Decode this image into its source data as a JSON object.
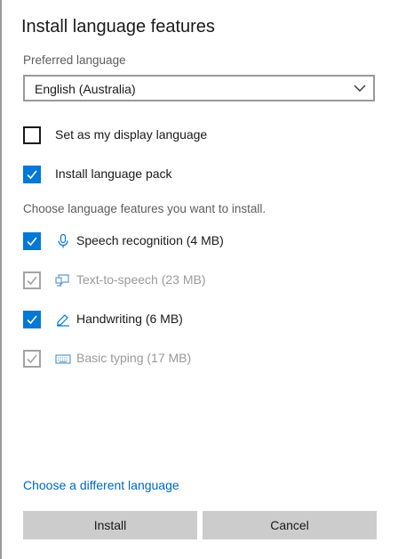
{
  "dialog": {
    "title": "Install language features",
    "preferred_language_label": "Preferred language",
    "preferred_language_value": "English (Australia)"
  },
  "options": {
    "display_language": {
      "label": "Set as my display language",
      "checked": false
    },
    "language_pack": {
      "label": "Install language pack",
      "checked": true
    }
  },
  "features": {
    "hint": "Choose language features you want to install.",
    "items": [
      {
        "label": "Speech recognition (4 MB)",
        "checked": true,
        "disabled": false,
        "icon": "microphone-icon"
      },
      {
        "label": "Text-to-speech (23 MB)",
        "checked": true,
        "disabled": true,
        "icon": "speech-bubble-monitor-icon"
      },
      {
        "label": "Handwriting (6 MB)",
        "checked": true,
        "disabled": false,
        "icon": "pen-icon"
      },
      {
        "label": "Basic typing (17 MB)",
        "checked": true,
        "disabled": true,
        "icon": "keyboard-icon"
      }
    ]
  },
  "footer": {
    "link": "Choose a different language",
    "install_label": "Install",
    "cancel_label": "Cancel"
  },
  "colors": {
    "accent": "#0078d7",
    "link": "#0067c0",
    "button": "#cccccc"
  }
}
